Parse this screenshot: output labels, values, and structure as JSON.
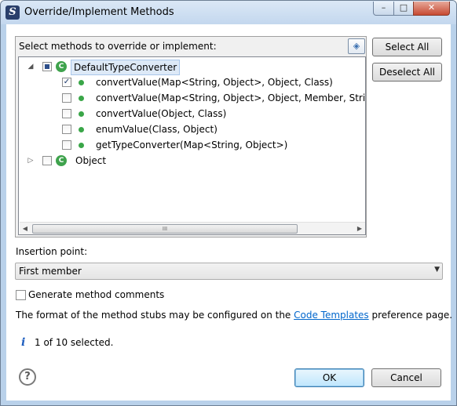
{
  "window": {
    "title": "Override/Implement Methods",
    "controls": {
      "minimize": "–",
      "maximize": "□",
      "close": "✕"
    }
  },
  "methods_group": {
    "label": "Select methods to override or implement:",
    "tree": [
      {
        "label": "DefaultTypeConverter",
        "expanded": true,
        "check": "partial",
        "icon": "class-icon",
        "children": [
          {
            "label": "convertValue(Map<String, Object>, Object, Class)",
            "checked": true
          },
          {
            "label": "convertValue(Map<String, Object>, Object, Member, String",
            "checked": false
          },
          {
            "label": "convertValue(Object, Class)",
            "checked": false
          },
          {
            "label": "enumValue(Class, Object)",
            "checked": false
          },
          {
            "label": "getTypeConverter(Map<String, Object>)",
            "checked": false
          }
        ]
      },
      {
        "label": "Object",
        "expanded": false,
        "check": "unchecked",
        "icon": "class-icon"
      }
    ],
    "scroll_grip": "III"
  },
  "buttons": {
    "select_all": "Select All",
    "deselect_all": "Deselect All",
    "ok": "OK",
    "cancel": "Cancel"
  },
  "insertion": {
    "label": "Insertion point:",
    "value": "First member"
  },
  "generate_comments": {
    "label": "Generate method comments",
    "checked": false
  },
  "format_note": {
    "before": "The format of the method stubs may be configured on the ",
    "link": "Code Templates",
    "after": " preference page."
  },
  "status": {
    "icon": "i",
    "text": "1 of 10 selected."
  },
  "help": "?"
}
